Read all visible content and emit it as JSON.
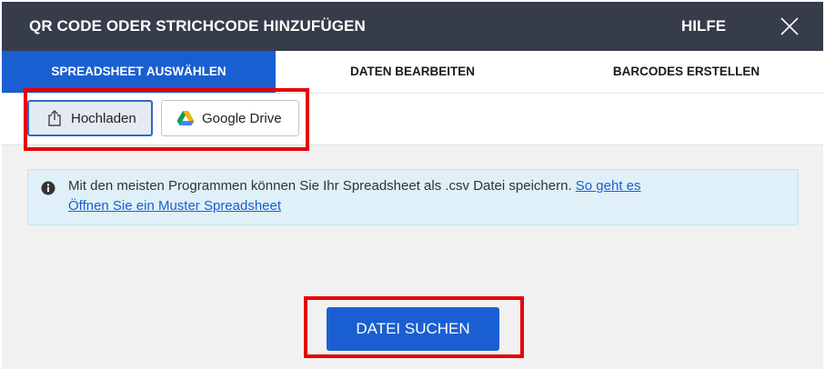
{
  "header": {
    "title": "QR CODE ODER STRICHCODE HINZUFÜGEN",
    "help_label": "HILFE"
  },
  "tabs": [
    {
      "label": "SPREADSHEET AUSWÄHLEN",
      "active": true
    },
    {
      "label": "DATEN BEARBEITEN",
      "active": false
    },
    {
      "label": "BARCODES ERSTELLEN",
      "active": false
    }
  ],
  "source": {
    "upload_label": "Hochladen",
    "drive_label": "Google Drive",
    "selected": "upload"
  },
  "info": {
    "text": "Mit den meisten Programmen können Sie Ihr Spreadsheet als .csv Datei speichern.",
    "howto_link": "So geht es",
    "sample_link": "Öffnen Sie ein Muster Spreadsheet"
  },
  "actions": {
    "browse_label": "DATEI SUCHEN"
  },
  "colors": {
    "header_bg": "#373c4b",
    "accent": "#1a5fd1",
    "highlight": "#e60000",
    "info_bg": "#dff0f8"
  }
}
